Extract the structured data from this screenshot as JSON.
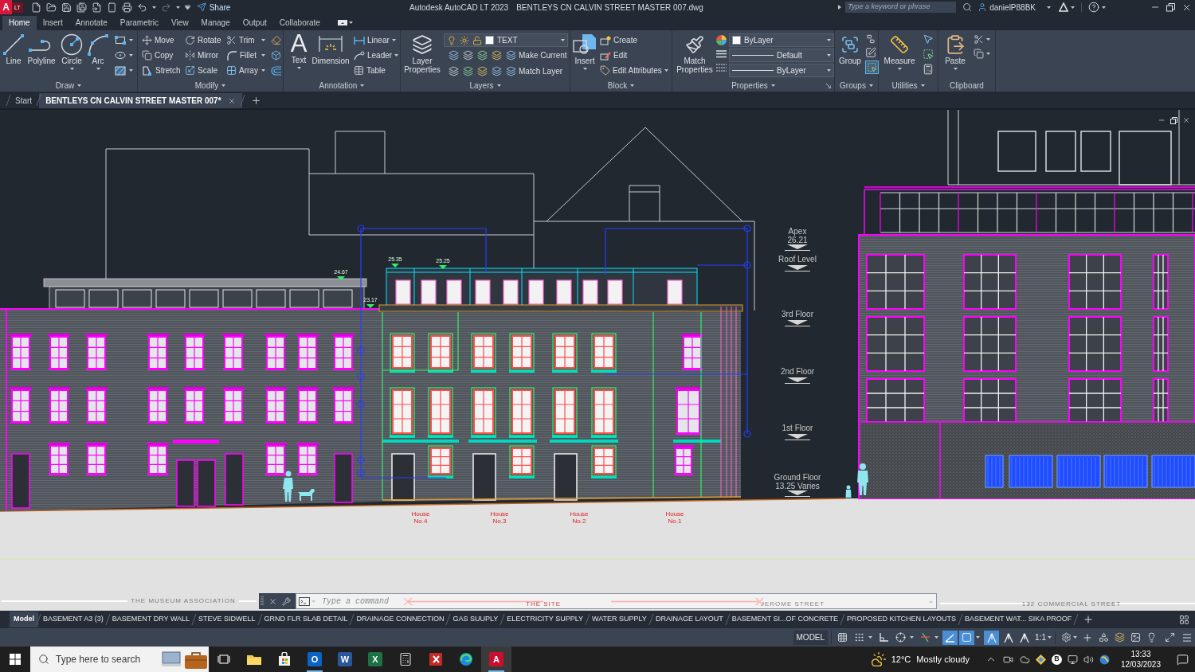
{
  "title_bar": {
    "logo": "A",
    "edition": "LT",
    "share": "Share",
    "app_title": "Autodesk AutoCAD LT 2023",
    "file_title": "BENTLEYS CN CALVIN STREET MASTER 007.dwg",
    "search": {
      "placeholder": "Type a keyword or phrase"
    },
    "user": "danielP88BK"
  },
  "ribbon_tabs": [
    {
      "label": "Home",
      "selected": true
    },
    {
      "label": "Insert",
      "selected": false
    },
    {
      "label": "Annotate",
      "selected": false
    },
    {
      "label": "Parametric",
      "selected": false
    },
    {
      "label": "View",
      "selected": false
    },
    {
      "label": "Manage",
      "selected": false
    },
    {
      "label": "Output",
      "selected": false
    },
    {
      "label": "Collaborate",
      "selected": false
    }
  ],
  "ribbon": {
    "draw": {
      "title": "Draw",
      "tools": [
        "Line",
        "Polyline",
        "Circle",
        "Arc"
      ]
    },
    "modify": {
      "title": "Modify",
      "tools": [
        [
          "Move",
          "Rotate",
          "Trim"
        ],
        [
          "Copy",
          "Mirror",
          "Fillet"
        ],
        [
          "Stretch",
          "Scale",
          "Array"
        ]
      ]
    },
    "annotation": {
      "title": "Annotation",
      "text_glyph": "A",
      "text": "Text",
      "dimension": "Dimension",
      "tools": [
        "Linear",
        "Leader",
        "Table"
      ]
    },
    "layers": {
      "title": "Layers",
      "properties": "Layer Properties",
      "current_layer": "TEXT",
      "tools": [
        "Make Current",
        "Match Layer"
      ]
    },
    "block": {
      "title": "Block",
      "insert": "Insert",
      "tools": [
        "Create",
        "Edit",
        "Edit Attributes"
      ]
    },
    "properties": {
      "title": "Properties",
      "match": "Match Properties",
      "color_setting": "ByLayer",
      "lineweight": "Default",
      "linetype": "ByLayer"
    },
    "groups": {
      "title": "Groups",
      "group": "Group",
      "selection_on": true
    },
    "utilities": {
      "title": "Utilities",
      "measure": "Measure"
    },
    "clipboard": {
      "title": "Clipboard",
      "paste": "Paste"
    }
  },
  "file_tabs": [
    {
      "label": "Start",
      "selected": false
    },
    {
      "label": "BENTLEYS CN CALVIN STREET MASTER 007*",
      "selected": true
    }
  ],
  "drawing": {
    "levels": [
      {
        "label": "Apex",
        "value": "26.21"
      },
      {
        "label": "Roof Level"
      },
      {
        "label": "3rd Floor"
      },
      {
        "label": "2nd Floor"
      },
      {
        "label": "1st Floor"
      },
      {
        "label": "Ground Floor",
        "value": "13.25 Varies"
      }
    ],
    "spot_levels": [
      "24.67",
      "25.35",
      "25.25",
      "23.17"
    ],
    "house_labels": [
      {
        "label": "House",
        "number": "No.4"
      },
      {
        "label": "House",
        "number": "No.3"
      },
      {
        "label": "House",
        "number": "No.2"
      },
      {
        "label": "House",
        "number": "No.1"
      }
    ],
    "street_labels": [
      "THE MUSEUM ASSOCIATION",
      "THE SITE",
      "JEROME STREET",
      "132 COMMERCIAL STREET"
    ]
  },
  "command_line": {
    "placeholder": "Type a command"
  },
  "layout_tabs": [
    {
      "label": "Model",
      "selected": true
    },
    {
      "label": "BASEMENT A3 (3)",
      "selected": false
    },
    {
      "label": "BASEMENT DRY WALL",
      "selected": false
    },
    {
      "label": "STEVE SIDWELL",
      "selected": false
    },
    {
      "label": "GRND FLR SLAB DETAIL",
      "selected": false
    },
    {
      "label": "DRAINAGE CONNECTION",
      "selected": false
    },
    {
      "label": "GAS SUUPLY",
      "selected": false
    },
    {
      "label": "ELECTRICITY SUPPLY",
      "selected": false
    },
    {
      "label": "WATER SUPPLY",
      "selected": false
    },
    {
      "label": "DRAINAGE LAYOUT",
      "selected": false
    },
    {
      "label": "BASEMENT SI...OF CONCRETE",
      "selected": false
    },
    {
      "label": "PROPOSED KITCHEN LAYOUTS",
      "selected": false
    },
    {
      "label": "BASEMENT WAT... SIKA PROOF",
      "selected": false
    }
  ],
  "status_bar": {
    "space": "MODEL",
    "toggles": [
      {
        "kind": "grid",
        "on": false
      },
      {
        "kind": "snap",
        "on": false
      },
      {
        "kind": "ortho",
        "on": false
      },
      {
        "kind": "polar",
        "on": false
      },
      {
        "kind": "tracking",
        "on": false
      },
      {
        "kind": "isodraft",
        "on": true
      },
      {
        "kind": "osnap",
        "on": true
      },
      {
        "kind": "annotation_visibility",
        "on": true
      },
      {
        "kind": "autoscale",
        "on": false
      }
    ],
    "scale": "1:1"
  },
  "taskbar": {
    "search": {
      "placeholder": "Type here to search"
    },
    "apps": [
      {
        "kind": "folder",
        "selected": false,
        "running": false
      },
      {
        "kind": "store",
        "selected": false,
        "running": false
      },
      {
        "kind": "mail",
        "glyph": "O",
        "selected": false,
        "running": true
      },
      {
        "kind": "document",
        "glyph": "W",
        "selected": false,
        "running": false
      },
      {
        "kind": "spreadsheet",
        "glyph": "X",
        "selected": false,
        "running": false
      },
      {
        "kind": "calculator",
        "selected": false,
        "running": false
      },
      {
        "kind": "pdf",
        "selected": false,
        "running": false
      },
      {
        "kind": "browser",
        "selected": false,
        "running": false
      },
      {
        "kind": "cad",
        "glyph": "A",
        "selected": true,
        "running": true
      }
    ],
    "weather": {
      "temperature": "12°C",
      "condition": "Mostly cloudy"
    },
    "tray_badge": "B",
    "time": "13:33",
    "date": "12/03/2023"
  }
}
